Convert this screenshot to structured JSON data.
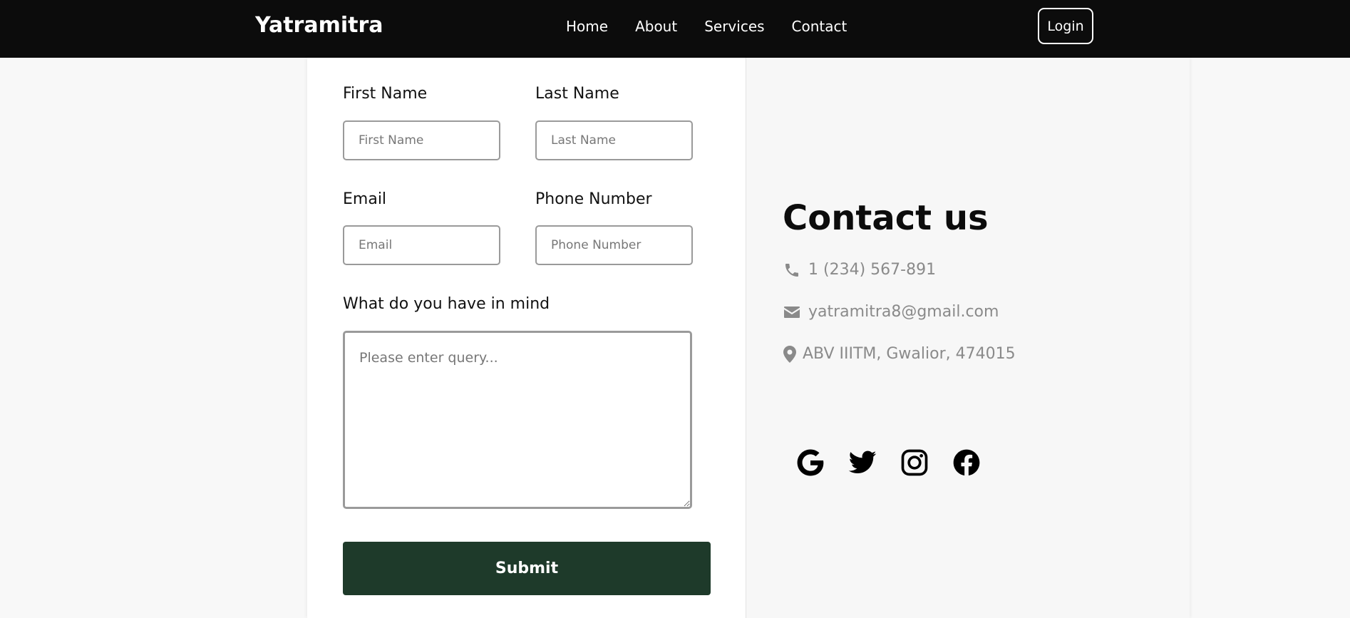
{
  "header": {
    "brand": "Yatramitra",
    "nav": [
      "Home",
      "About",
      "Services",
      "Contact"
    ],
    "login_label": "Login"
  },
  "form": {
    "first_name": {
      "label": "First Name",
      "placeholder": "First Name",
      "value": ""
    },
    "last_name": {
      "label": "Last Name",
      "placeholder": "Last Name",
      "value": ""
    },
    "email": {
      "label": "Email",
      "placeholder": "Email",
      "value": ""
    },
    "phone": {
      "label": "Phone Number",
      "placeholder": "Phone Number",
      "value": ""
    },
    "query": {
      "label": "What do you have in mind",
      "placeholder": "Please enter query...",
      "value": ""
    },
    "submit_label": "Submit"
  },
  "contact": {
    "title": "Contact us",
    "phone": {
      "icon": "phone-icon",
      "text": "1 (234) 567-891"
    },
    "email": {
      "icon": "envelope-icon",
      "text": "yatramitra8@gmail.com"
    },
    "address": {
      "icon": "map-pin-icon",
      "text": "ABV IIITM, Gwalior, 474015"
    }
  },
  "socials": [
    "google-icon",
    "twitter-icon",
    "instagram-icon",
    "facebook-icon"
  ],
  "colors": {
    "navbar": "#0c0c0c",
    "submit": "#1e3a2a",
    "muted_text": "#8a8a8a"
  }
}
